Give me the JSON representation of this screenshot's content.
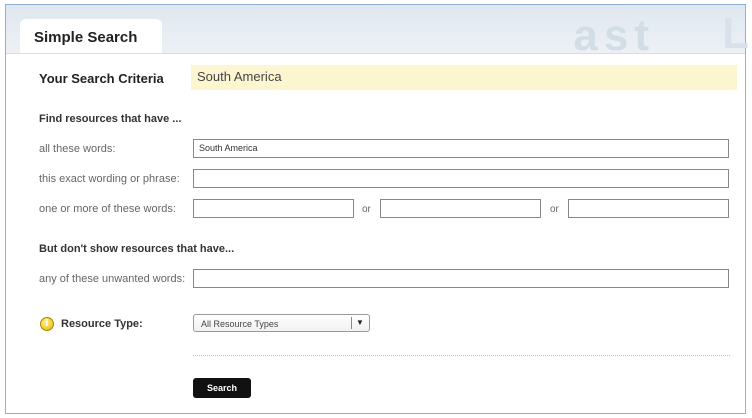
{
  "tab": {
    "title": "Simple Search"
  },
  "criteria": {
    "label": "Your Search Criteria",
    "value": "South America"
  },
  "find_section": {
    "title": "Find resources that have ...",
    "all_words": {
      "label": "all these words:",
      "value": "South America"
    },
    "exact_phrase": {
      "label": "this exact wording or phrase:",
      "value": ""
    },
    "any_words": {
      "label": "one or more of these words:",
      "values": [
        "",
        "",
        ""
      ],
      "or_text": "or"
    }
  },
  "exclude_section": {
    "title": "But don't show resources that have...",
    "unwanted": {
      "label": "any of these unwanted words:",
      "value": ""
    }
  },
  "resource_type": {
    "icon": "info-icon",
    "label": "Resource Type:",
    "selected": "All Resource Types"
  },
  "search_button": {
    "label": "Search"
  },
  "colors": {
    "criteria_bg": "#fcf6d0",
    "frame_border": "#8fb1d6",
    "button_bg": "#111111"
  }
}
